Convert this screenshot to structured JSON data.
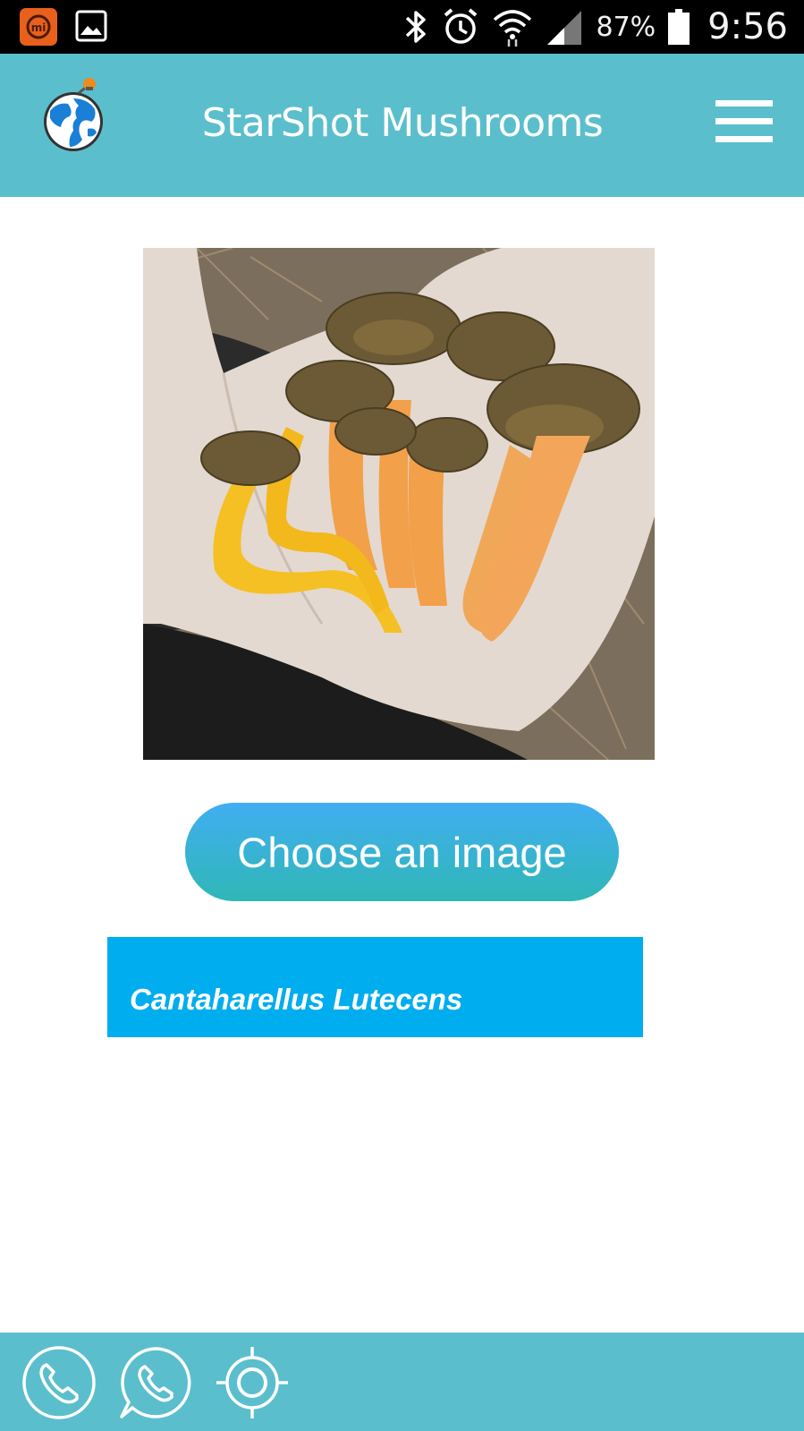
{
  "status_bar": {
    "battery_percent": "87%",
    "time": "9:56",
    "left_icons": [
      "mi-app-icon",
      "gallery-icon"
    ],
    "right_icons": [
      "bluetooth-icon",
      "alarm-icon",
      "wifi-icon",
      "signal-icon",
      "battery-icon"
    ],
    "battery_level": 0.87,
    "signal_level": 0.5
  },
  "header": {
    "title": "StarShot Mushrooms",
    "logo": "globe-logo",
    "menu_icon": "hamburger-menu-icon"
  },
  "main": {
    "photo": "mushroom-photo",
    "choose_button_label": "Choose an image",
    "result_label": "Cantaharellus Lutecens"
  },
  "bottom_bar": {
    "icons": [
      "phone-icon",
      "whatsapp-icon",
      "location-target-icon"
    ]
  },
  "colors": {
    "header_bg": "#5bbecc",
    "result_bg": "#00adee",
    "button_gradient_top": "#41aef2",
    "button_gradient_bottom": "#2fb7b6"
  }
}
